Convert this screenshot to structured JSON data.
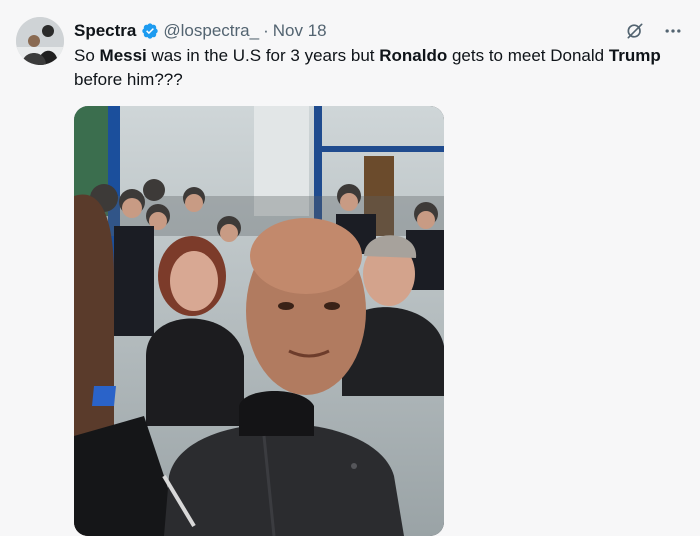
{
  "tweet": {
    "author_name": "Spectra",
    "handle": "@lospectra_",
    "separator": "·",
    "date": "Nov 18",
    "text_parts": {
      "p1": "So ",
      "b1": "Messi",
      "p2": " was in the U.S for 3 years but ",
      "b2": "Ronaldo",
      "p3": " gets to meet Donald ",
      "b3": "Trump",
      "p4": " before him???"
    }
  },
  "icons": {
    "verified": "verified-badge-icon",
    "grok": "grok-icon",
    "more": "more-icon"
  },
  "colors": {
    "verified_blue": "#1d9bf0",
    "text_primary": "#0f1419",
    "text_secondary": "#536471",
    "background": "#f7f7f8"
  }
}
